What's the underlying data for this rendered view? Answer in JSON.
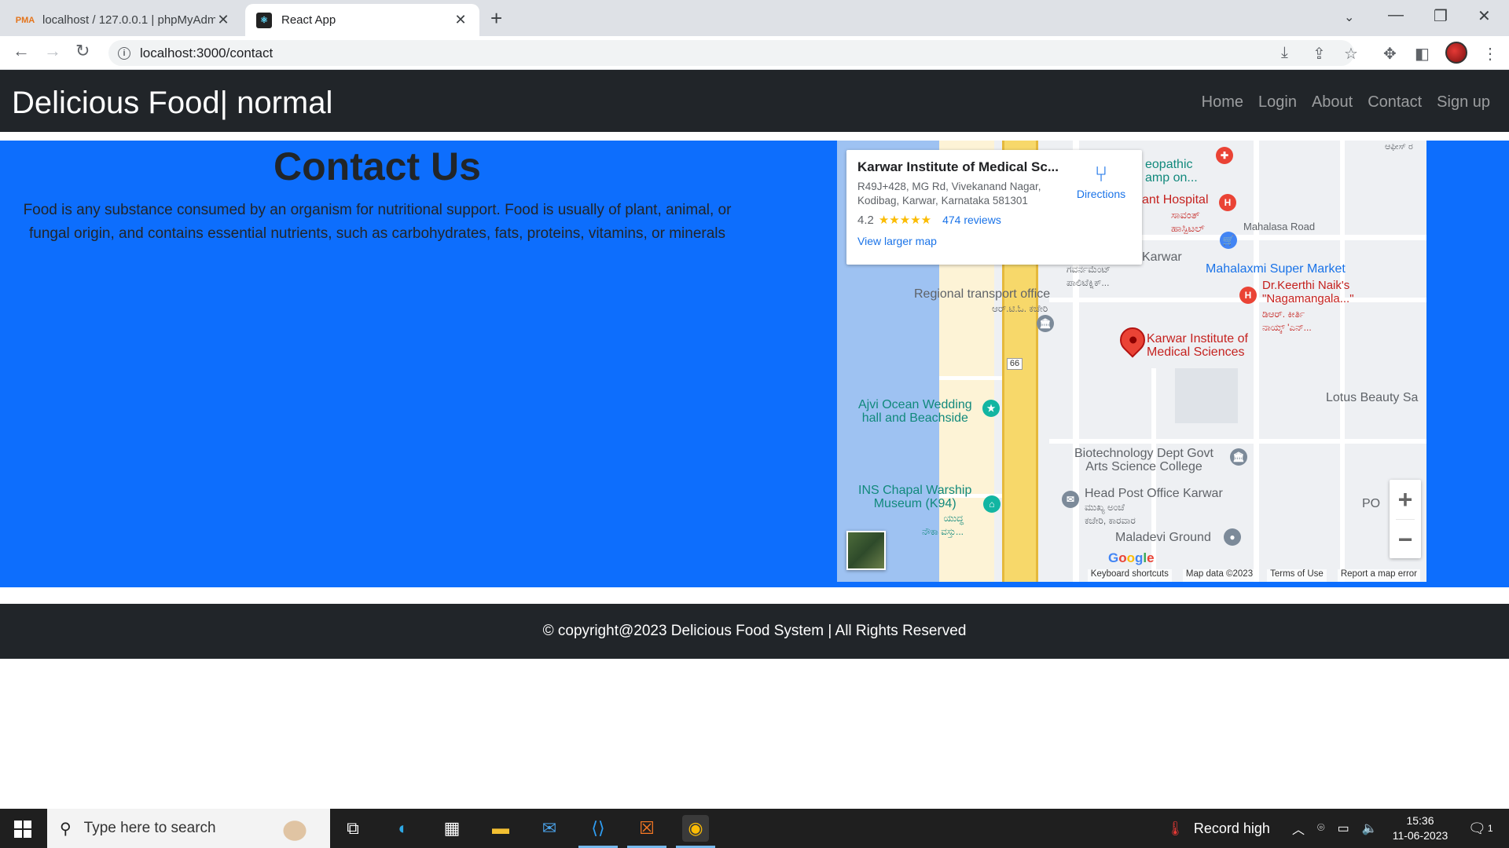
{
  "browser": {
    "tabs": [
      {
        "title": "localhost / 127.0.0.1 | phpMyAdmin",
        "favicon": "phpmyadmin-icon",
        "active": false
      },
      {
        "title": "React App",
        "favicon": "react-icon",
        "active": true
      }
    ],
    "url": "localhost:3000/contact"
  },
  "navbar": {
    "brand": "Delicious Food| normal",
    "links": [
      "Home",
      "Login",
      "About",
      "Contact",
      "Sign up"
    ]
  },
  "contact": {
    "title": "Contact Us",
    "text": "Food is any substance consumed by an organism for nutritional support. Food is usually of plant, animal, or fungal origin, and contains essential nutrients, such as carbohydrates, fats, proteins, vitamins, or minerals"
  },
  "map": {
    "card": {
      "title": "Karwar Institute of Medical Sc...",
      "address": "R49J+428, MG Rd, Vivekanand Nagar, Kodibag, Karwar, Karnataka 581301",
      "rating": "4.2",
      "stars": "★★★★★",
      "reviews": "474 reviews",
      "view_larger": "View larger map",
      "directions": "Directions"
    },
    "labels": {
      "homeopathic": "eopathic\namp on...",
      "hospital": "ant Hospital",
      "hospital_kn": "ಸಾವಂತ್\nಹಾಸ್ಪಿಟಲ್",
      "mahalasa": "Mahalasa Road",
      "karwar": "Karwar",
      "mahalaxmi": "Mahalaxmi Super Market",
      "drkeerthi": "Dr.Keerthi Naik's\n\"Nagamangala...\"",
      "drkeerthi_kn": "ಡಿಆರ್. ಕೀರ್ತಿ\nನಾಯ್ಕ್ 'ಎನ್...",
      "polytechnic_kn": "ಗವರ್ನಮೆಂಟ್\nಪಾಲಿಟೆಕ್ನಿಕ್...",
      "rto": "Regional transport office",
      "rto_kn": "ಆರ್.ಟಿ.ಓ. ಕಚೇರಿ",
      "kims": "Karwar Institute of\nMedical Sciences",
      "route": "66",
      "lotus": "Lotus Beauty Sa",
      "ajvi": "Ajvi Ocean Wedding\nhall and Beachside",
      "biotech": "Biotechnology Dept Govt\nArts Science College",
      "ins": "INS Chapal Warship\nMuseum (K94)",
      "ins_kn": "ಯುದ್ಧ\nನೌಕಾ ವಸ್ತು...",
      "postoffice": "Head Post Office Karwar",
      "postoffice_kn": "ಮುಖ್ಯ ಅಂಚೆ\nಕಚೇರಿ, ಕಾರವಾರ",
      "maladevi": "Maladevi Ground",
      "po": "PO",
      "top_kn": "ಆಫೀಸ್ ರ"
    },
    "zoom_in": "+",
    "zoom_out": "−",
    "google": "Google",
    "attribution": [
      "Keyboard shortcuts",
      "Map data ©2023",
      "Terms of Use",
      "Report a map error"
    ]
  },
  "footer": {
    "text": "© copyright@2023 Delicious Food System | All Rights Reserved"
  },
  "taskbar": {
    "search_placeholder": "Type here to search",
    "weather": "Record high",
    "time": "15:36",
    "date": "11-06-2023",
    "notification_count": "1"
  }
}
